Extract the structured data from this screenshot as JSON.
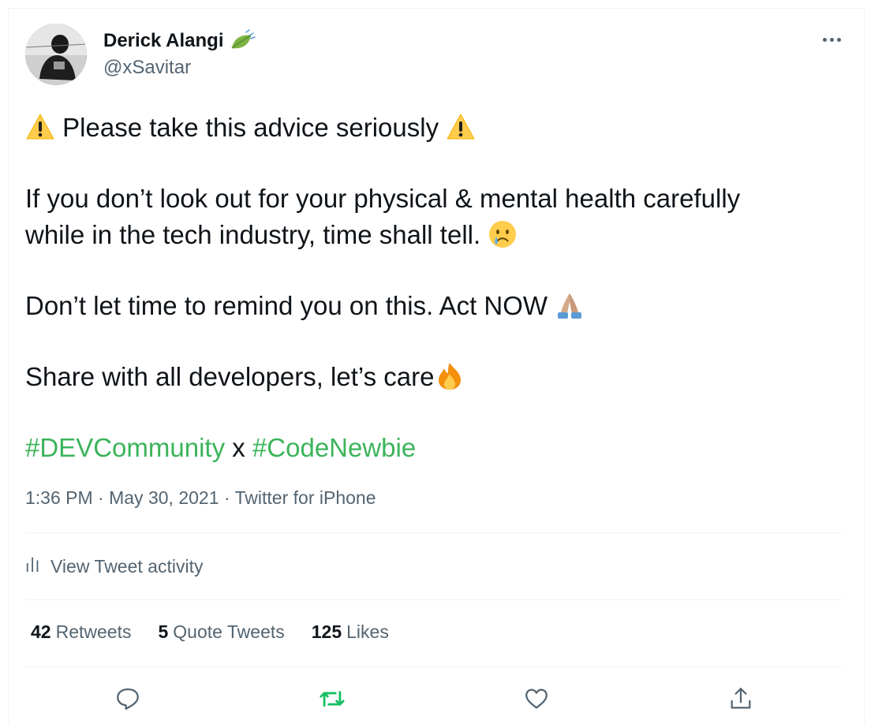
{
  "author": {
    "display_name": "Derick Alangi",
    "handle": "@xSavitar",
    "badge_icon": "leaf-fluttering-in-wind-icon"
  },
  "tweet": {
    "line1": "Please take this advice seriously",
    "line2": "If you don’t look out for your physical & mental health carefully",
    "line3": "while in the tech industry, time shall tell.",
    "line4": "Don’t let time to remind you on this. Act NOW",
    "line5": "Share with all developers, let’s care",
    "hashtag1": "#DEVCommunity",
    "hashtag_separator": "x",
    "hashtag2": "#CodeNewbie",
    "emojis": [
      "warning-icon",
      "crying-face-icon",
      "folded-hands-icon",
      "fire-icon"
    ]
  },
  "meta": {
    "time": "1:36 PM",
    "date": "May 30, 2021",
    "source": "Twitter for iPhone",
    "separator": " · "
  },
  "activity": {
    "label": "View Tweet activity"
  },
  "stats": {
    "retweets_count": "42",
    "retweets_label": "Retweets",
    "quotes_count": "5",
    "quotes_label": "Quote Tweets",
    "likes_count": "125",
    "likes_label": "Likes"
  },
  "colors": {
    "hashtag": "#3bb45a",
    "muted": "#536471",
    "text": "#0f1419",
    "retweet_active": "#17bf63"
  }
}
